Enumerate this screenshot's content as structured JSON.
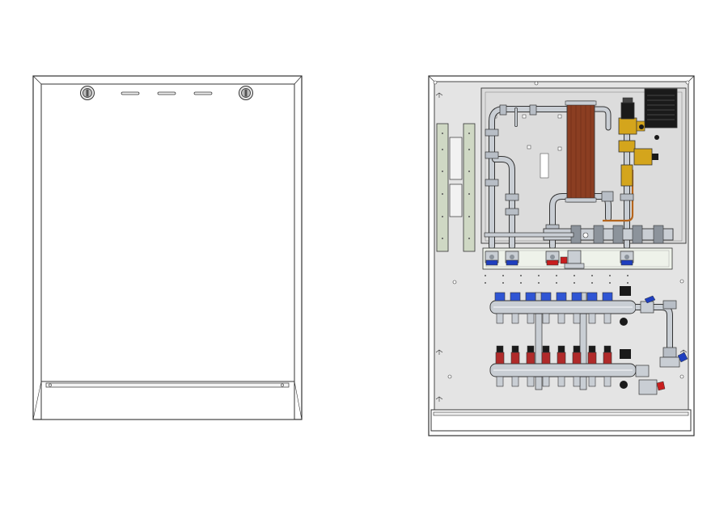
{
  "drawing": {
    "views": [
      {
        "id": "front-closed",
        "depicts": "cabinet-with-closed-door"
      },
      {
        "id": "front-open",
        "depicts": "cabinet-interior-with-hydraulic-station"
      }
    ],
    "colors": {
      "line": "#333333",
      "panel": "#e4e4e4",
      "panel_inner": "#dcdcdc",
      "door": "#ffffff",
      "steel": "#c9ced4",
      "steel_dark": "#8c939b",
      "copper_plate": "#8b3e22",
      "copper_pipe": "#b5651d",
      "brass": "#d4a51c",
      "valve_blue": "#1f3fbf",
      "valve_red": "#c81e1e",
      "cap_blue": "#2f55d4",
      "cap_red": "#b02a2a",
      "black": "#1a1a1a",
      "bracket": "#cfd8c4"
    },
    "counts": {
      "supply_manifold_outlets": 8,
      "return_manifold_outlets": 8
    }
  }
}
